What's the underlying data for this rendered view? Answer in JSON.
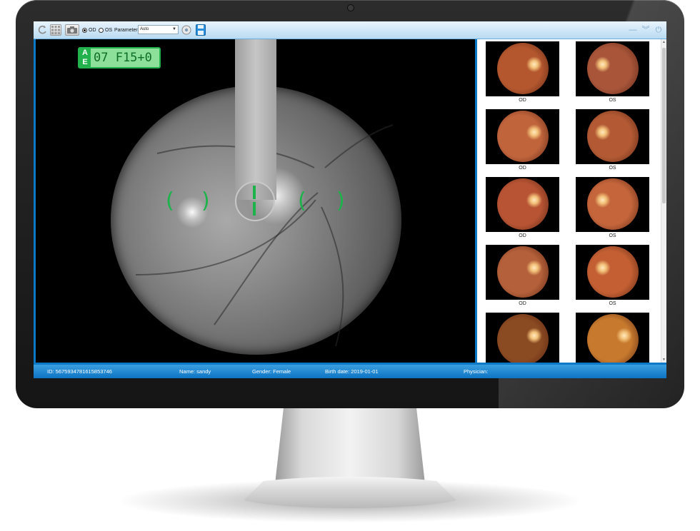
{
  "toolbar": {
    "eye_options": [
      {
        "label": "OD",
        "selected": true
      },
      {
        "label": "OS",
        "selected": false
      }
    ],
    "parameter_label": "Parameter",
    "parameter_value": "Auto"
  },
  "live_view": {
    "ae_letters": [
      "A",
      "E"
    ],
    "ae_value": "07 F15+0"
  },
  "gallery": {
    "thumbnails": [
      {
        "label": "OD",
        "tone": "#b4572f"
      },
      {
        "label": "OS",
        "tone": "#a8553a"
      },
      {
        "label": "OD",
        "tone": "#c0643c"
      },
      {
        "label": "OS",
        "tone": "#b35a34"
      },
      {
        "label": "OD",
        "tone": "#b85434"
      },
      {
        "label": "OS",
        "tone": "#c4653b"
      },
      {
        "label": "OD",
        "tone": "#b4603a"
      },
      {
        "label": "OS",
        "tone": "#c35f33"
      },
      {
        "label": "",
        "tone": "#8a4a22"
      },
      {
        "label": "",
        "tone": "#c77a2e"
      }
    ]
  },
  "status": {
    "id": "ID: 5675934781615853746",
    "name": "Name: sandy",
    "gender": "Gender: Female",
    "birth_date": "Birth date: 2019-01-01",
    "physician": "Physician:"
  },
  "colors": {
    "accent": "#0b78c8",
    "focus_green": "#22b14c"
  }
}
